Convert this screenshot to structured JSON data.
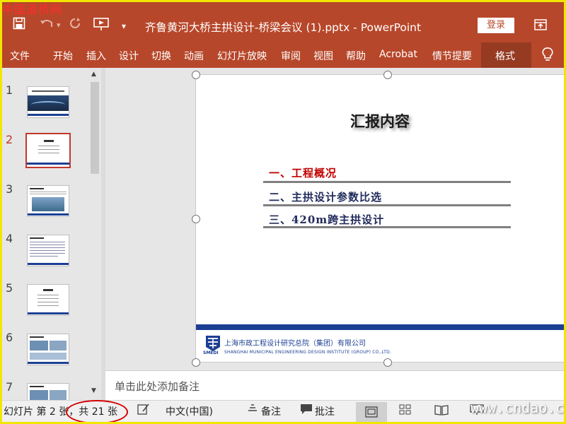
{
  "watermark_top": "中国道桥网",
  "watermark_bottom": "www.cndao.com",
  "titlebar": {
    "title": "齐鲁黄河大桥主拱设计-桥梁会议 (1).pptx  -  PowerPoint",
    "login_label": "登录"
  },
  "ribbon": {
    "tabs": [
      "文件",
      "开始",
      "插入",
      "设计",
      "切换",
      "动画",
      "幻灯片放映",
      "审阅",
      "视图",
      "帮助",
      "Acrobat",
      "情节提要"
    ],
    "active_tab": "格式"
  },
  "thumbnails": {
    "numbers": [
      "1",
      "2",
      "3",
      "4",
      "5",
      "6",
      "7"
    ],
    "selected": "2"
  },
  "slide": {
    "title": "汇报内容",
    "agenda": [
      {
        "text": "一、工程概况",
        "color": "#c00000"
      },
      {
        "text": "二、主拱设计参数比选",
        "color": "#1f2a5a"
      },
      {
        "text": "三、420m跨主拱设计",
        "color": "#1f2a5a"
      }
    ],
    "company_cn": "上海市政工程设计研究总院（集团）有限公司",
    "company_en": "SHANGHAI MUNICIPAL ENGINEERING DESIGN INSTITUTE (GROUP) CO.,LTD.",
    "logo_text": "SMEDI"
  },
  "notes": {
    "placeholder": "单击此处添加备注"
  },
  "statusbar": {
    "slide_info": "幻灯片 第 2 张，共 21 张",
    "language": "中文(中国)",
    "notes_label": "备注",
    "comments_label": "批注"
  },
  "colors": {
    "accent": "#b7472a",
    "accent_dark": "#963a22",
    "selection": "#c0392b",
    "slide_band": "#1c3f94"
  }
}
